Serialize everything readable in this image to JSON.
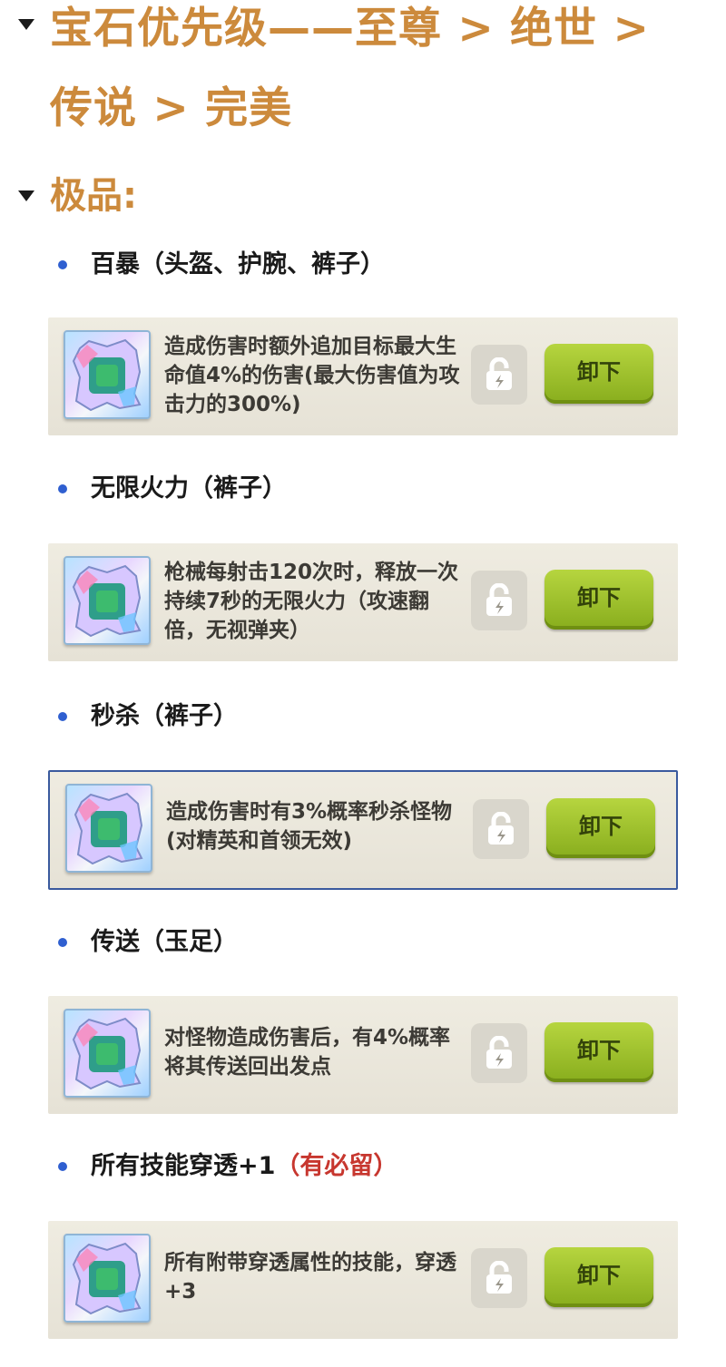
{
  "heading": {
    "title": "宝石优先级——至尊 > 绝世 > 传说 > 完美"
  },
  "subheading": {
    "title": "极品:"
  },
  "gems": [
    {
      "name": "百暴（头盔、护腕、裤子）",
      "note": "",
      "desc": "造成伤害时额外追加目标最大生命值4%的伤害(最大伤害值为攻击力的300%)",
      "button": "卸下",
      "selected": false
    },
    {
      "name": "无限火力（裤子）",
      "note": "",
      "desc": "枪械每射击120次时，释放一次持续7秒的无限火力（攻速翻倍，无视弹夹）",
      "button": "卸下",
      "selected": false
    },
    {
      "name": "秒杀（裤子）",
      "note": "",
      "desc": "造成伤害时有3%概率秒杀怪物(对精英和首领无效)",
      "button": "卸下",
      "selected": true
    },
    {
      "name": "传送（玉足）",
      "note": "",
      "desc": "对怪物造成伤害后，有4%概率将其传送回出发点",
      "button": "卸下",
      "selected": false
    },
    {
      "name": "所有技能穿透+1",
      "note": "（有必留）",
      "desc": "所有附带穿透属性的技能，穿透+3",
      "button": "卸下",
      "selected": false
    }
  ],
  "icons": {
    "caret": "caret-down-icon",
    "gem": "gem-icon",
    "lock": "lock-icon"
  },
  "colors": {
    "heading": "#cc8a3c",
    "bullet": "#2f5fd0",
    "note": "#c7372f",
    "button": "#9cc12a"
  }
}
